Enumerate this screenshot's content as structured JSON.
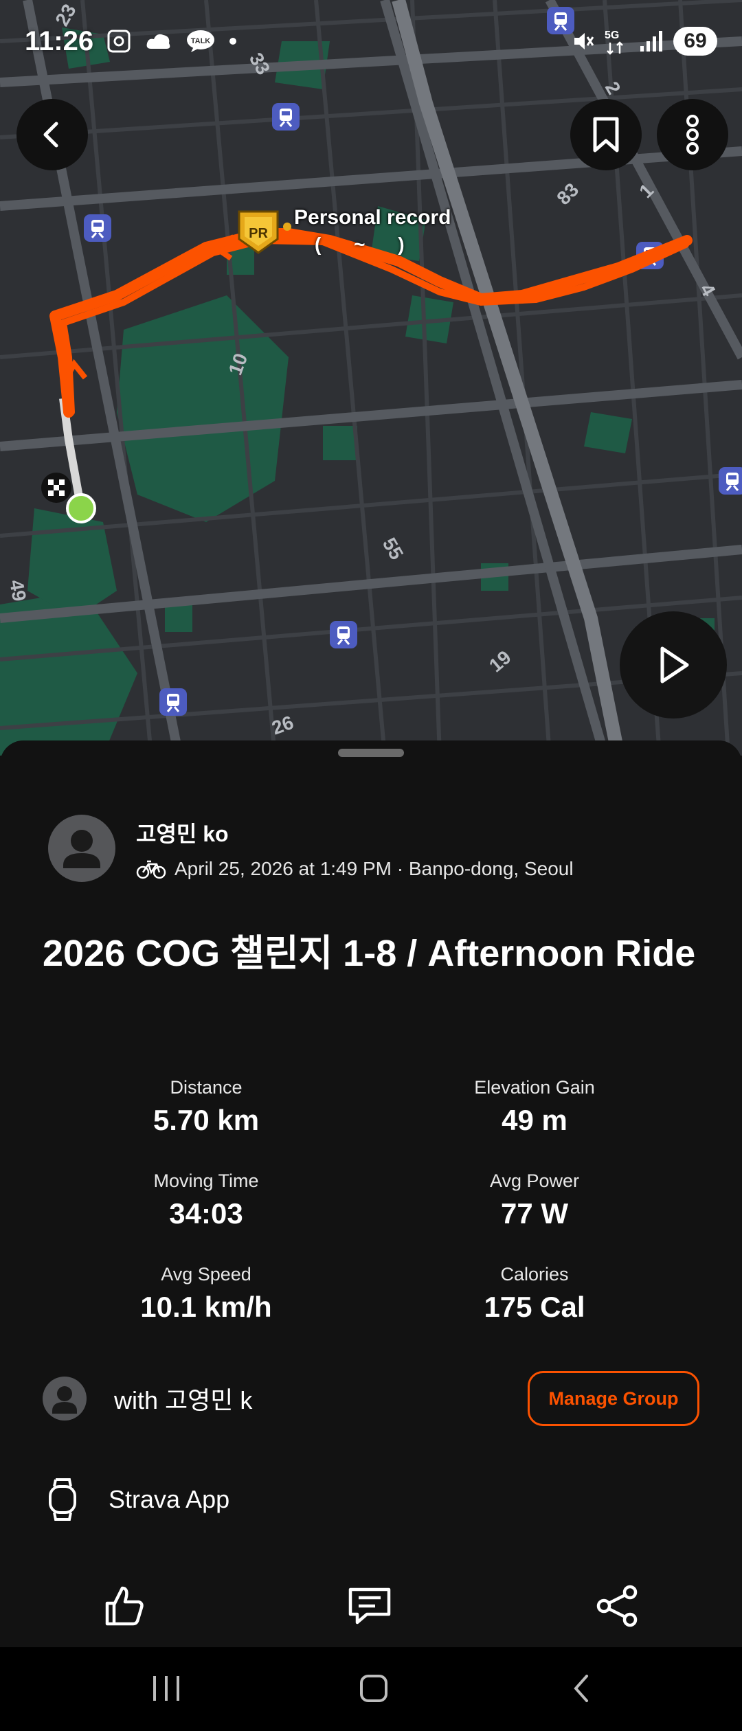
{
  "status_bar": {
    "time": "11:26",
    "battery": "69",
    "network": "5G",
    "icons": [
      "screenshot-icon",
      "weather-icon",
      "talk-icon",
      "dot-icon",
      "mute-icon",
      "network-5g-icon",
      "signal-icon",
      "battery-icon"
    ]
  },
  "map": {
    "personal_record_label": "Personal record",
    "personal_record_sub": "( ~ )",
    "pr_badge": "PR",
    "route_color": "#fc5200",
    "road_numbers": [
      "23",
      "33",
      "2",
      "83",
      "1",
      "4",
      "10",
      "55",
      "19",
      "26",
      "49"
    ],
    "buttons": {
      "back_icon": "back-arrow-icon",
      "bookmark_icon": "bookmark-icon",
      "more_icon": "more-vertical-icon",
      "play_icon": "play-icon"
    }
  },
  "athlete": {
    "name": "고영민 ko",
    "sport_icon": "bike-icon",
    "meta": "April 25, 2026 at 1:49 PM · Banpo-dong, Seoul"
  },
  "activity": {
    "title": "2026 COG 챌린지 1-8 / Afternoon Ride"
  },
  "stats": [
    {
      "label": "Distance",
      "value": "5.70 km"
    },
    {
      "label": "Elevation Gain",
      "value": "49 m"
    },
    {
      "label": "Moving Time",
      "value": "34:03"
    },
    {
      "label": "Avg Power",
      "value": "77 W"
    },
    {
      "label": "Avg Speed",
      "value": "10.1 km/h"
    },
    {
      "label": "Calories",
      "value": "175 Cal"
    }
  ],
  "group": {
    "text": "with 고영민 k",
    "button_label": "Manage Group"
  },
  "device": {
    "name": "Strava App",
    "icon": "watch-icon"
  },
  "actions": {
    "kudos_icon": "thumbs-up-icon",
    "comment_icon": "comment-icon",
    "share_icon": "share-icon"
  },
  "nav_bar": {
    "icons": [
      "recent-apps-icon",
      "home-icon",
      "back-icon"
    ]
  },
  "colors": {
    "accent": "#fc5200",
    "sheet_bg": "#121212",
    "map_bg": "#2e3034",
    "park": "#1f5a45",
    "start_marker": "#8bd44a"
  }
}
